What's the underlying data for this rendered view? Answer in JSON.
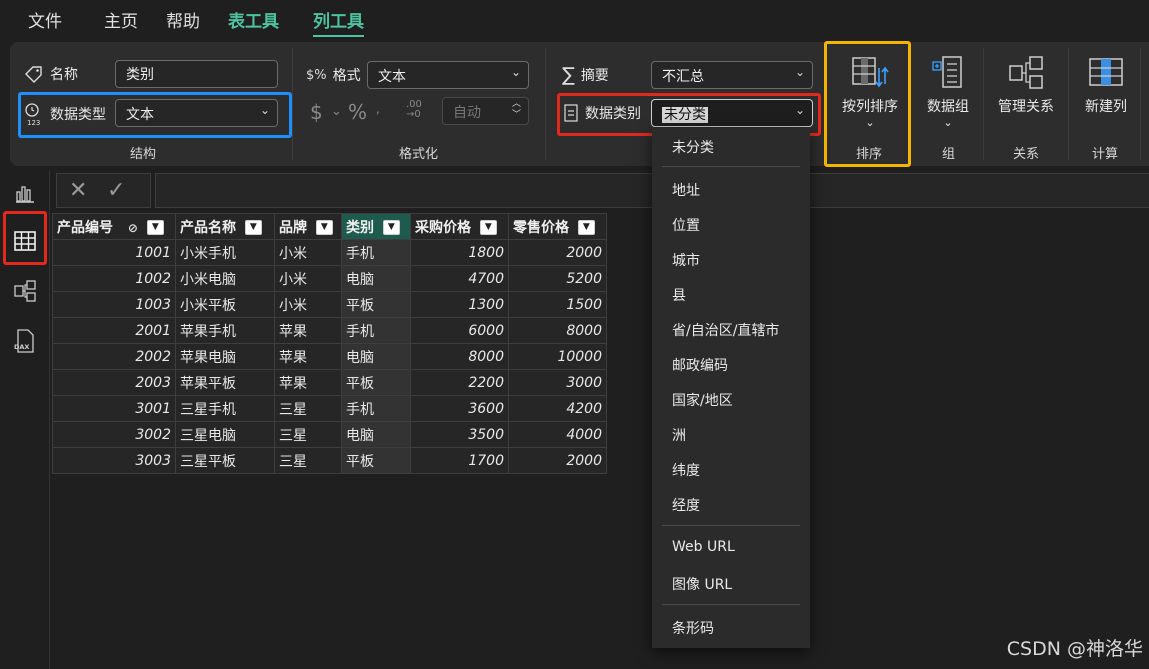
{
  "menu": {
    "file": "文件",
    "home": "主页",
    "help": "帮助",
    "table_tools": "表工具",
    "column_tools": "列工具"
  },
  "ribbon": {
    "structure": {
      "name_label": "名称",
      "name_value": "类别",
      "datatype_label": "数据类型",
      "datatype_value": "文本",
      "group_label": "结构"
    },
    "formatting": {
      "format_label": "格式",
      "format_value": "文本",
      "currency_symbol": "$",
      "percent_symbol": "%",
      "decimal_value": "自动",
      "group_label": "格式化"
    },
    "properties": {
      "summary_label": "摘要",
      "summary_value": "不汇总",
      "category_label": "数据类别",
      "category_value": "未分类"
    },
    "sort": {
      "button": "按列排序",
      "group_label": "排序"
    },
    "groups": {
      "button": "数据组",
      "group_label": "组"
    },
    "relationships": {
      "button": "管理关系",
      "group_label": "关系"
    },
    "calculations": {
      "button": "新建列",
      "group_label": "计算"
    }
  },
  "colors": {
    "accent": "#4fc3a1",
    "highlight_blue": "#1f8fff",
    "highlight_red": "#e3281e",
    "highlight_orange": "#f5b400",
    "selected_header": "#1e5a4e"
  },
  "table": {
    "headers": [
      "产品编号",
      "产品名称",
      "品牌",
      "类别",
      "采购价格",
      "零售价格"
    ],
    "rows": [
      [
        "1001",
        "小米手机",
        "小米",
        "手机",
        "1800",
        "2000"
      ],
      [
        "1002",
        "小米电脑",
        "小米",
        "电脑",
        "4700",
        "5200"
      ],
      [
        "1003",
        "小米平板",
        "小米",
        "平板",
        "1300",
        "1500"
      ],
      [
        "2001",
        "苹果手机",
        "苹果",
        "手机",
        "6000",
        "8000"
      ],
      [
        "2002",
        "苹果电脑",
        "苹果",
        "电脑",
        "8000",
        "10000"
      ],
      [
        "2003",
        "苹果平板",
        "苹果",
        "平板",
        "2200",
        "3000"
      ],
      [
        "3001",
        "三星手机",
        "三星",
        "手机",
        "3600",
        "4200"
      ],
      [
        "3002",
        "三星电脑",
        "三星",
        "电脑",
        "3500",
        "4000"
      ],
      [
        "3003",
        "三星平板",
        "三星",
        "平板",
        "1700",
        "2000"
      ]
    ]
  },
  "dropdown": {
    "items": [
      "未分类",
      "地址",
      "位置",
      "城市",
      "县",
      "省/自治区/直辖市",
      "邮政编码",
      "国家/地区",
      "洲",
      "纬度",
      "经度",
      "Web URL",
      "图像 URL",
      "条形码"
    ]
  },
  "watermark": "CSDN @神洛华"
}
